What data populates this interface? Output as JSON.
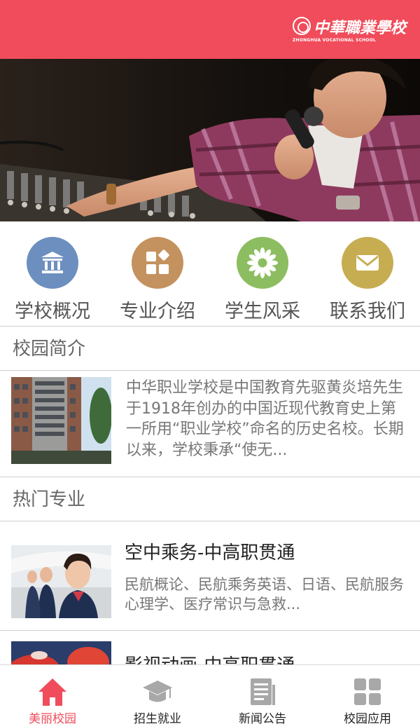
{
  "header": {
    "logo_cn": "中華職業學校",
    "logo_en": "ZHONGHUA VOCATIONAL SCHOOL",
    "background": "#f04c5b"
  },
  "quick_nav": [
    {
      "label": "学校概况",
      "icon": "building-icon",
      "color": "#6c8fbf"
    },
    {
      "label": "专业介绍",
      "icon": "apps-icon",
      "color": "#c4925f"
    },
    {
      "label": "学生风采",
      "icon": "flower-icon",
      "color": "#8cbd60"
    },
    {
      "label": "联系我们",
      "icon": "mail-icon",
      "color": "#c7ad52"
    }
  ],
  "intro": {
    "title": "校园简介",
    "text": "中华职业学校是中国教育先驱黄炎培先生于1918年创办的中国近现代教育史上第一所用“职业学校”命名的历史名校。长期以来，学校秉承“使无..."
  },
  "majors": {
    "title": "热门专业",
    "items": [
      {
        "title": "空中乘务-中高职贯通",
        "desc": "民航概论、民航乘务英语、日语、民航服务心理学、医疗常识与急救..."
      },
      {
        "title": "影视动画-中高职贯通",
        "desc": ""
      }
    ]
  },
  "tabbar": [
    {
      "label": "美丽校园",
      "icon": "home-icon",
      "active": true
    },
    {
      "label": "招生就业",
      "icon": "graduation-cap-icon",
      "active": false
    },
    {
      "label": "新闻公告",
      "icon": "news-icon",
      "active": false
    },
    {
      "label": "校园应用",
      "icon": "grid-icon",
      "active": false
    }
  ],
  "colors": {
    "accent": "#f04c5b",
    "inactive_icon": "#a8a8a8"
  }
}
